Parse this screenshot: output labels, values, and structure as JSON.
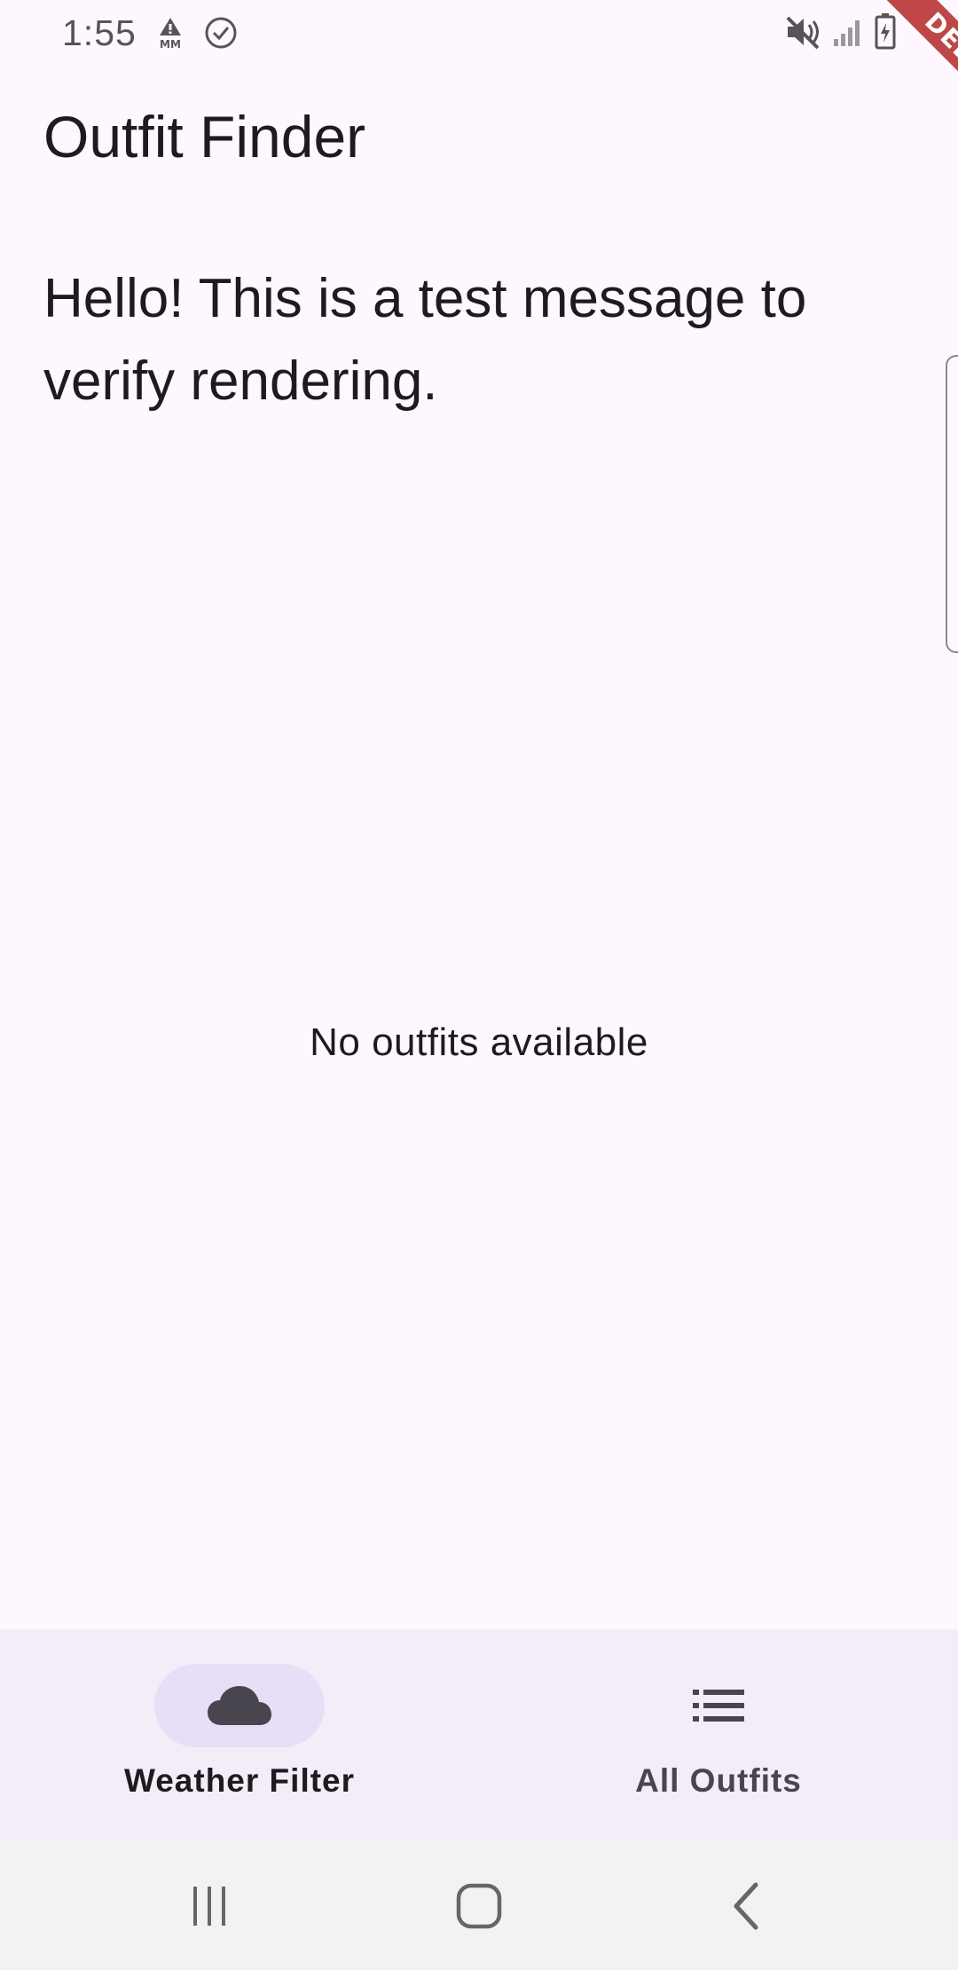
{
  "status_bar": {
    "time": "1:55",
    "icons": [
      "alert-mm-icon",
      "check-circle-icon",
      "mute-icon",
      "signal-icon",
      "battery-icon"
    ]
  },
  "debug_banner": {
    "label": "DEBUG",
    "color": "#B42828"
  },
  "app_bar": {
    "title": "Outfit Finder"
  },
  "main": {
    "test_message": "Hello! This is a test message to verify rendering.",
    "empty_state": "No outfits available"
  },
  "bottom_nav": {
    "items": [
      {
        "label": "Weather Filter",
        "icon": "cloud-icon",
        "active": true
      },
      {
        "label": "All Outfits",
        "icon": "list-icon",
        "active": false
      }
    ]
  },
  "system_nav": {
    "buttons": [
      "recent-apps-icon",
      "home-icon",
      "back-icon"
    ]
  },
  "colors": {
    "background": "#FEF7FF",
    "nav_background": "#F3EDF7",
    "nav_indicator": "#E8DEF8",
    "text": "#1D1B20"
  }
}
